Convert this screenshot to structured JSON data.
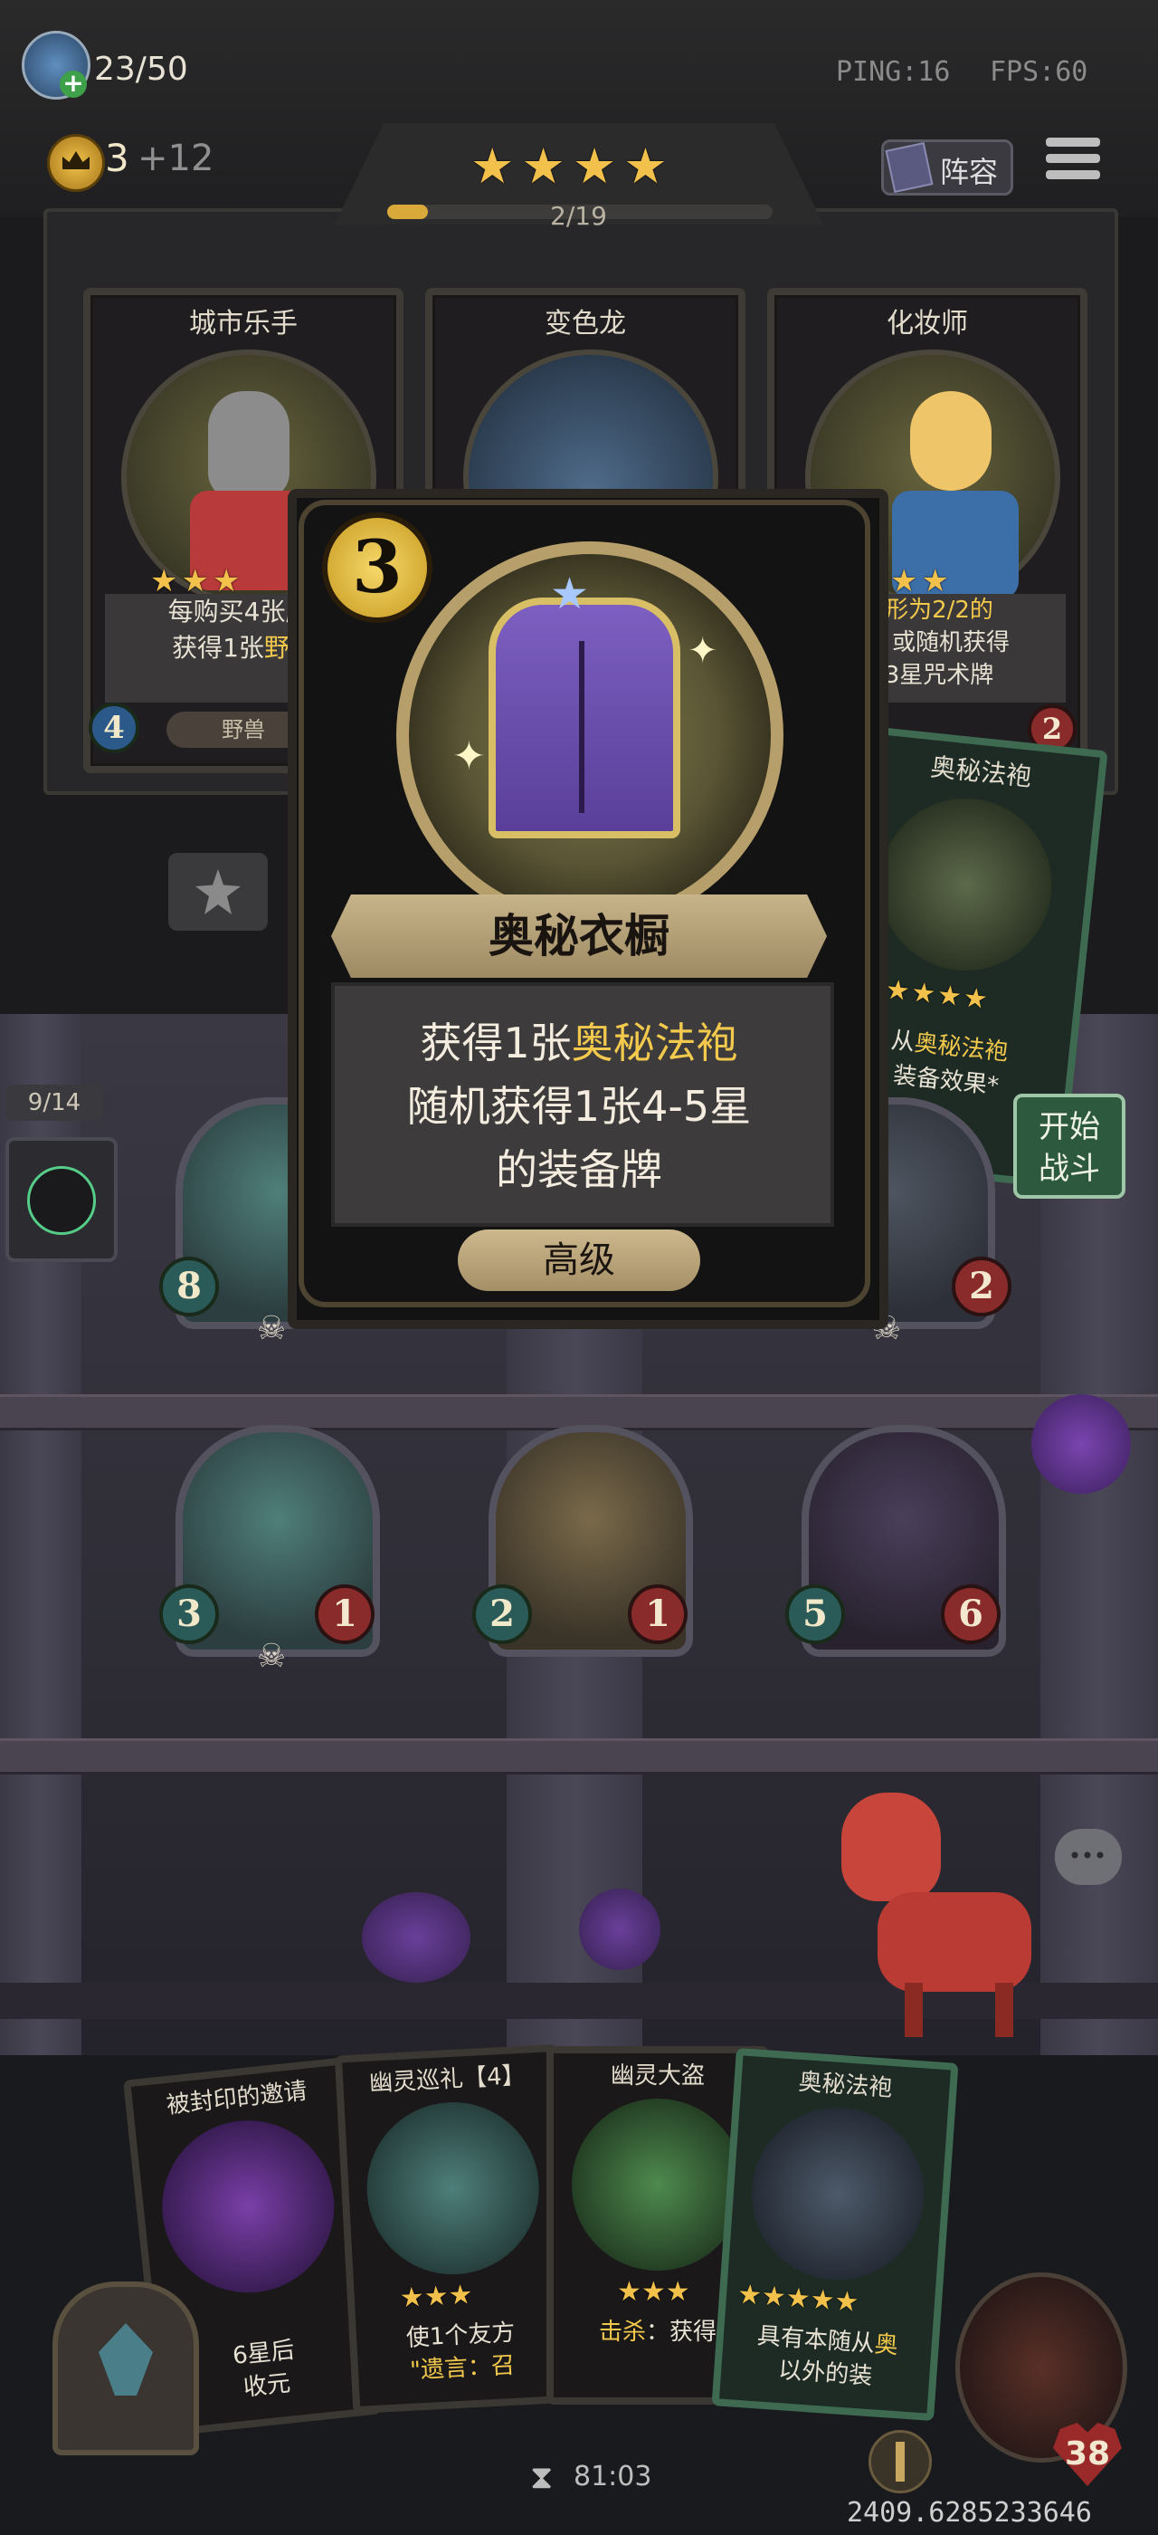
{
  "hud": {
    "population": "23/50",
    "ping": "PING:16",
    "fps": "FPS:60",
    "gold": "3",
    "gold_income": "+12",
    "tavern_stars": 4,
    "progress": "2/19",
    "progress_fraction": 0.105,
    "lineup_label": "阵容"
  },
  "shop": {
    "cards": [
      {
        "name": "城市乐手",
        "stars": 3,
        "desc_line1": "每购买4张牌,",
        "desc_line2a": "获得1张",
        "desc_line2b": "野兽",
        "tag": "野兽",
        "atk": "4"
      },
      {
        "name": "变色龙",
        "stars": 0
      },
      {
        "name": "化妆师",
        "stars": 2,
        "desc_line1": "变形为2/2的",
        "desc_line2": "从，或随机获得",
        "desc_line3": "张3星咒术牌",
        "hp": "2"
      }
    ],
    "side_card": {
      "name": "奥秘法袍",
      "stars": 5,
      "desc_line1a": "从",
      "desc_line1b": "奥秘法袍",
      "desc_line2": "装备效果*",
      "tag": "牌"
    }
  },
  "selected_card": {
    "cost": "3",
    "name": "奥秘衣橱",
    "desc_line1a": "获得1张",
    "desc_line1b": "奥秘法袍",
    "desc_line2": "随机获得1张4-5星",
    "desc_line3": "的装备牌",
    "rarity": "高级"
  },
  "board": {
    "hero_counter": "9/14",
    "minions_row1": [
      {
        "atk": "8"
      },
      {
        "hp": "2"
      }
    ],
    "minions_row2": [
      {
        "atk": "3",
        "hp": "1"
      },
      {
        "atk": "2",
        "hp": "1"
      },
      {
        "atk": "5",
        "hp": "6"
      }
    ],
    "start_battle_line1": "开始",
    "start_battle_line2": "战斗"
  },
  "hand": {
    "cards": [
      {
        "name": "被封印的邀请",
        "desc_line1": "6星后",
        "desc_line2": "收元"
      },
      {
        "name": "幽灵巡礼【4】",
        "stars": 3,
        "desc_line1": "使1个友方",
        "desc_line2": "\"遗言：召"
      },
      {
        "name": "幽灵大盗",
        "stars": 3,
        "desc_line1a": "击杀",
        "desc_line1b": "：获得"
      },
      {
        "name": "奥秘法袍",
        "stars": 5,
        "desc_line1a": "具有本随从",
        "desc_line1b": "奥",
        "desc_line2": "以外的装"
      }
    ]
  },
  "footer": {
    "timer": "81:03",
    "player_health": "38",
    "coordinates": "2409.6285233646"
  }
}
